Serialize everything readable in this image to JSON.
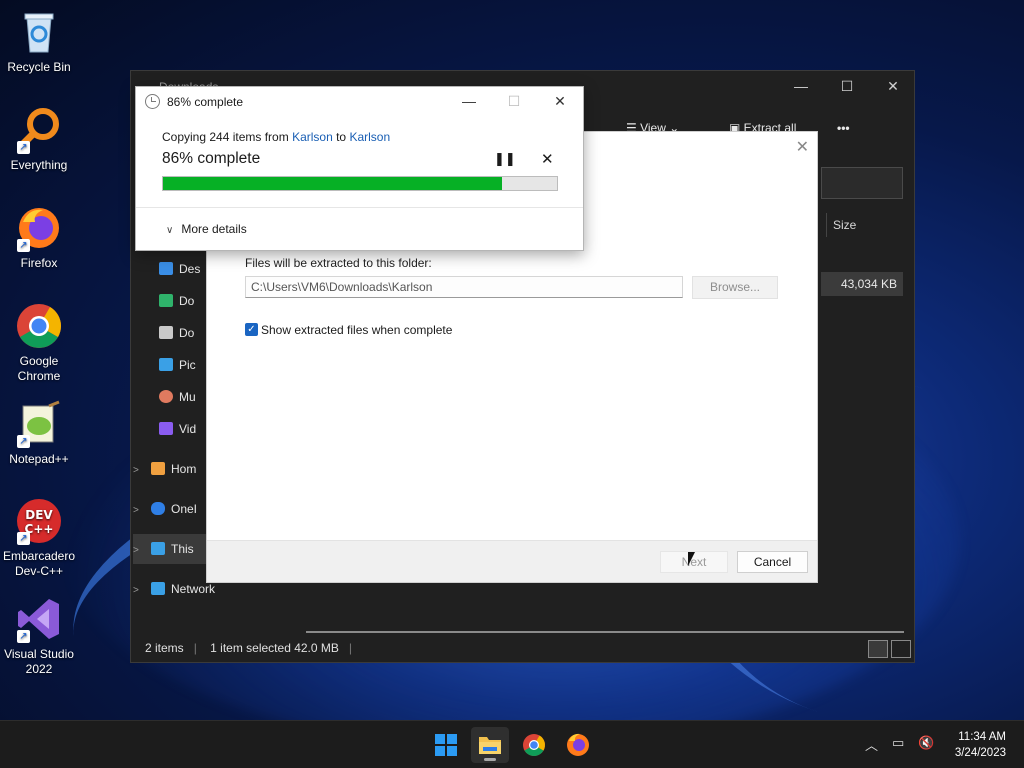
{
  "desktop": {
    "icons": [
      {
        "label": "Recycle Bin",
        "icon": "recycle-bin-icon"
      },
      {
        "label": "Everything",
        "icon": "everything-search-icon"
      },
      {
        "label": "Firefox",
        "icon": "firefox-icon"
      },
      {
        "label": "Google Chrome",
        "icon": "chrome-icon"
      },
      {
        "label": "Notepad++",
        "icon": "notepadpp-icon"
      },
      {
        "label": "Embarcadero Dev-C++",
        "icon": "devcpp-icon"
      },
      {
        "label": "Visual Studio 2022",
        "icon": "visual-studio-icon"
      }
    ]
  },
  "explorer": {
    "title": "Downloads",
    "toolbar": {
      "view_label": "View",
      "extract_all_label": "Extract all",
      "more": "•••"
    },
    "column_size": "Size",
    "file_size": "43,034 KB",
    "nav": [
      {
        "label": "Des",
        "color": "#3a8ee6"
      },
      {
        "label": "Do",
        "color": "#2fb36b"
      },
      {
        "label": "Do",
        "color": "#c9c9c9"
      },
      {
        "label": "Pic",
        "color": "#3aa0e6"
      },
      {
        "label": "Mu",
        "color": "#e07a5f"
      },
      {
        "label": "Vid",
        "color": "#8a5cf0"
      },
      {
        "label": "Hom",
        "color": "#f0a040"
      },
      {
        "label": "OneI",
        "color": "#2f7fe6"
      },
      {
        "label": "This",
        "color": "#3aa0e6"
      },
      {
        "label": "Network",
        "color": "#3aa0e6"
      }
    ],
    "status": {
      "items": "2 items",
      "selected": "1 item selected  42.0 MB"
    }
  },
  "extract_dialog": {
    "folder_label": "Files will be extracted to this folder:",
    "path": "C:\\Users\\VM6\\Downloads\\Karlson",
    "browse_label": "Browse...",
    "show_files_label": "Show extracted files when complete",
    "show_files_checked": true,
    "next_label": "Next",
    "cancel_label": "Cancel"
  },
  "progress_dialog": {
    "title": "86% complete",
    "copy_prefix": "Copying 244 items from ",
    "source": "Karlson",
    "to_word": " to ",
    "dest": "Karlson",
    "percent_text": "86% complete",
    "percent": 86,
    "more_details": "More details",
    "bar_color": "#06b025"
  },
  "taskbar": {
    "time": "11:34 AM",
    "date": "3/24/2023",
    "apps": [
      "start-icon",
      "file-explorer-icon",
      "chrome-icon",
      "firefox-icon"
    ]
  }
}
